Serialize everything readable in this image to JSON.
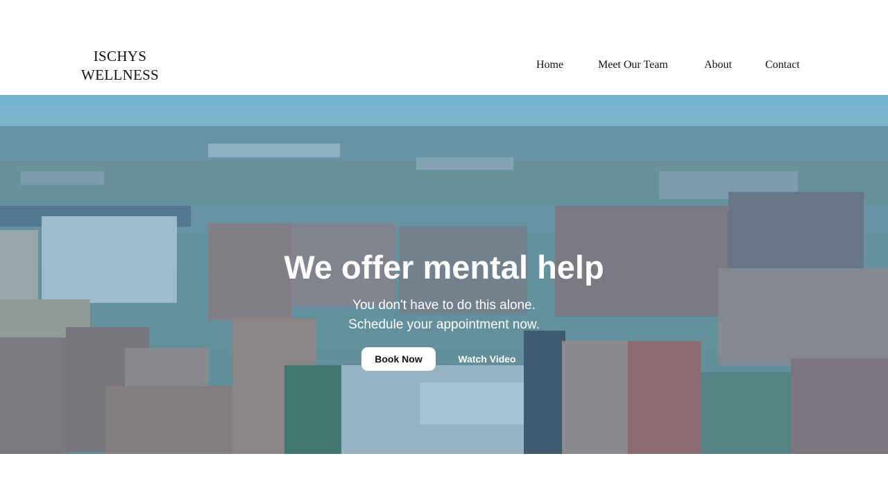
{
  "brand": {
    "line1": "ISCHYS",
    "line2": "WELLNESS"
  },
  "nav": {
    "items": [
      "Home",
      "Meet Our Team",
      "About",
      "Contact"
    ]
  },
  "hero": {
    "headline": "We offer mental help",
    "subline1": "You don't have to do this alone.",
    "subline2": "Schedule your appointment now.",
    "book_label": "Book Now",
    "watch_label": "Watch Video",
    "background": "city-aerial-photo"
  },
  "colors": {
    "overlay": "#468caf",
    "sky": "#8fcde3",
    "button_bg": "#ffffff",
    "text_dark": "#111111"
  }
}
